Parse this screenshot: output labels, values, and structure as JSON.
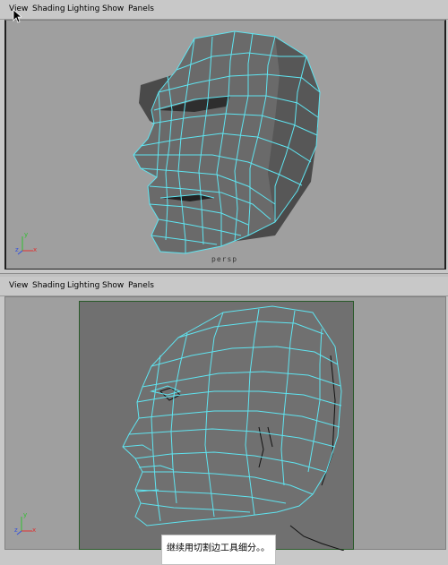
{
  "top_panel": {
    "menu": [
      "View",
      "Shading",
      "Lighting",
      "Show",
      "Panels"
    ],
    "camera_label": "persp",
    "axis": {
      "x": "x",
      "y": "y",
      "z": "z"
    }
  },
  "bottom_panel": {
    "menu": [
      "View",
      "Shading",
      "Lighting",
      "Show",
      "Panels"
    ],
    "axis": {
      "x": "x",
      "y": "y",
      "z": "z"
    },
    "caption": "继续用切割边工具细分。。"
  },
  "colors": {
    "wire": "#5fe4f0",
    "mesh_dark": "#555555",
    "mesh_mid": "#6a6a6a",
    "axis_x": "#e03030",
    "axis_y": "#30c030",
    "axis_z": "#3050e0"
  }
}
